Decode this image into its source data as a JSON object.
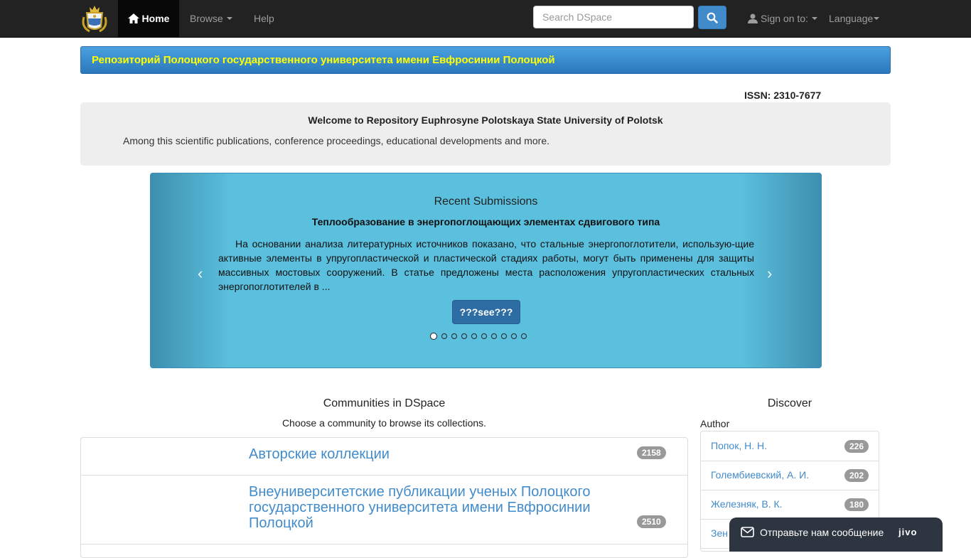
{
  "navbar": {
    "home_label": "Home",
    "browse_label": "Browse",
    "help_label": "Help",
    "search_placeholder": "Search DSpace",
    "sign_on_label": "Sign on to:",
    "language_label": "Language"
  },
  "banner": {
    "title": "Репозиторий Полоцкого государственного университета имени Евфросинии Полоцкой"
  },
  "issn": "ISSN: 2310-7677",
  "welcome": {
    "heading": "Welcome to Repository Euphrosyne Polotskaya State University of Polotsk",
    "text": "Among this scientific publications, conference proceedings, educational developments and more."
  },
  "carousel": {
    "heading": "Recent Submissions",
    "item_title": "Теплообразование в энергопоглощающих элементах сдвигового типа",
    "item_text": "На основании анализа литературных источников показано, что стальные энергопоглотители, использую-щие активные элементы в упругопластической и пластической стадиях работы, могут быть применены для защиты массивных мостовых сооружений. В статье предложены места расположения упругопластических стальных энергопоглотителей в ...",
    "button_label": "???see???",
    "prev_glyph": "‹",
    "next_glyph": "›",
    "slide_count": 10,
    "active_index": 0
  },
  "communities": {
    "heading": "Communities in DSpace",
    "subheading": "Choose a community to browse its collections.",
    "items": [
      {
        "name": "Авторские коллекции",
        "count": "2158"
      },
      {
        "name": "Внеуниверситетские публикации ученых Полоцкого государственного университета имени Евфросинии Полоцкой",
        "count": "2510"
      }
    ]
  },
  "discover": {
    "heading": "Discover",
    "facet_label": "Author",
    "items": [
      {
        "name": "Попок, Н. Н.",
        "count": "226"
      },
      {
        "name": "Голембиевский, А. И.",
        "count": "202"
      },
      {
        "name": "Железняк, В. К.",
        "count": "180"
      },
      {
        "name": "Зен",
        "count": ""
      }
    ]
  },
  "chat": {
    "text": "Отправьте нам сообщение",
    "brand": "jivo"
  },
  "colors": {
    "navbar_bg": "#222222",
    "banner_text": "#ffff00",
    "link": "#428bca",
    "carousel_bg": "#5bc0de"
  }
}
